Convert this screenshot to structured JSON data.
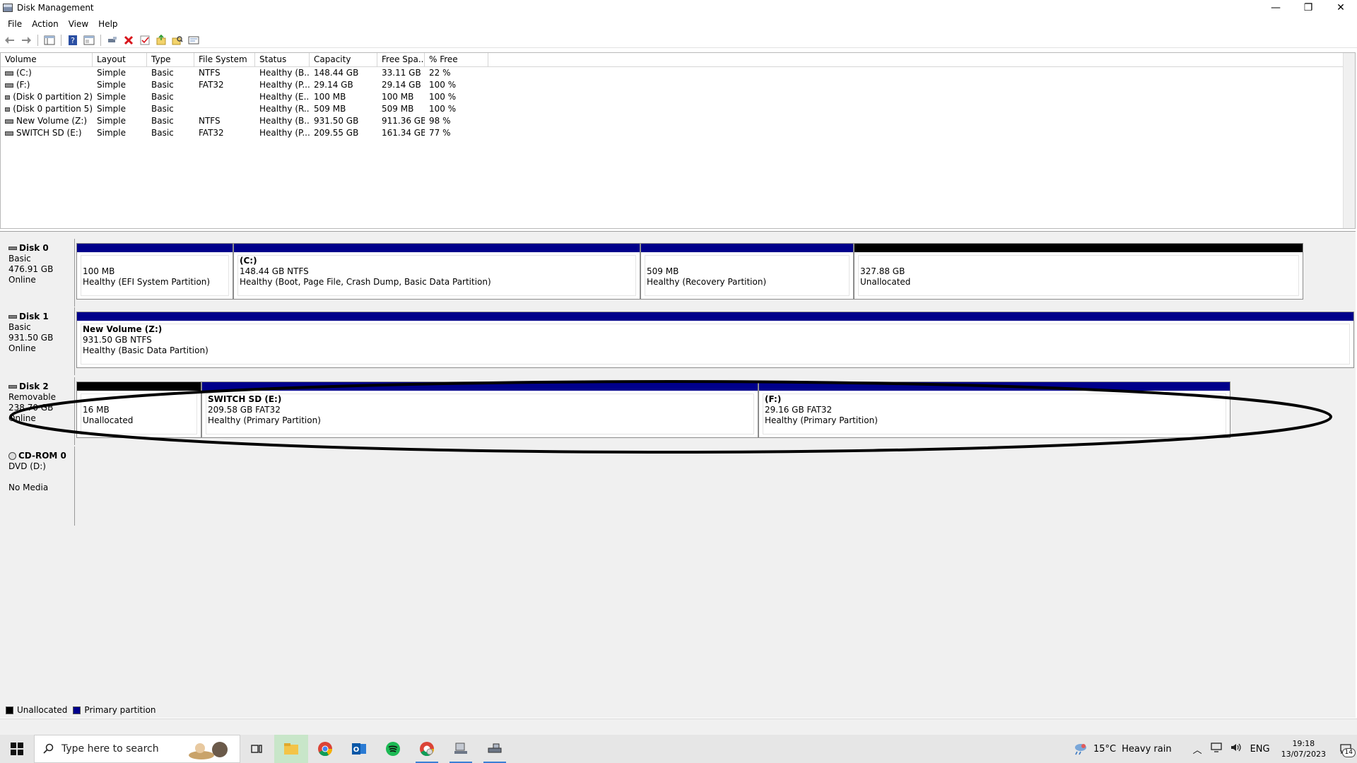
{
  "window": {
    "title": "Disk Management",
    "controls": [
      "—",
      "❐",
      "✕"
    ]
  },
  "menu": [
    "File",
    "Action",
    "View",
    "Help"
  ],
  "toolbar": [
    "back-arrow-icon",
    "forward-arrow-icon",
    "console-tree-icon",
    "help-icon",
    "properties-icon",
    "connect-icon",
    "delete-icon",
    "check-icon",
    "rescan-icon",
    "search-disk-icon",
    "settings-list-icon"
  ],
  "volume_table": {
    "columns": [
      "Volume",
      "Layout",
      "Type",
      "File System",
      "Status",
      "Capacity",
      "Free Spa...",
      "% Free"
    ],
    "rows": [
      [
        "(C:)",
        "Simple",
        "Basic",
        "NTFS",
        "Healthy (B...",
        "148.44 GB",
        "33.11 GB",
        "22 %"
      ],
      [
        "(F:)",
        "Simple",
        "Basic",
        "FAT32",
        "Healthy (P...",
        "29.14 GB",
        "29.14 GB",
        "100 %"
      ],
      [
        "(Disk 0 partition 2)",
        "Simple",
        "Basic",
        "",
        "Healthy (E...",
        "100 MB",
        "100 MB",
        "100 %"
      ],
      [
        "(Disk 0 partition 5)",
        "Simple",
        "Basic",
        "",
        "Healthy (R...",
        "509 MB",
        "509 MB",
        "100 %"
      ],
      [
        "New Volume (Z:)",
        "Simple",
        "Basic",
        "NTFS",
        "Healthy (B...",
        "931.50 GB",
        "911.36 GB",
        "98 %"
      ],
      [
        "SWITCH SD (E:)",
        "Simple",
        "Basic",
        "FAT32",
        "Healthy (P...",
        "209.55 GB",
        "161.34 GB",
        "77 %"
      ]
    ]
  },
  "disks": [
    {
      "name": "Disk 0",
      "kind": "Basic",
      "size": "476.91 GB",
      "state": "Online",
      "partitions": [
        {
          "label": "",
          "line1": "100 MB",
          "line2": "Healthy (EFI System Partition)",
          "bar": "primary"
        },
        {
          "label": "(C:)",
          "line1": "148.44 GB NTFS",
          "line2": "Healthy (Boot, Page File, Crash Dump, Basic Data Partition)",
          "bar": "primary"
        },
        {
          "label": "",
          "line1": "509 MB",
          "line2": "Healthy (Recovery Partition)",
          "bar": "primary"
        },
        {
          "label": "",
          "line1": "327.88 GB",
          "line2": "Unallocated",
          "bar": "unalloc"
        }
      ]
    },
    {
      "name": "Disk 1",
      "kind": "Basic",
      "size": "931.50 GB",
      "state": "Online",
      "partitions": [
        {
          "label": "New Volume  (Z:)",
          "line1": "931.50 GB NTFS",
          "line2": "Healthy (Basic Data Partition)",
          "bar": "primary"
        }
      ]
    },
    {
      "name": "Disk 2",
      "kind": "Removable",
      "size": "238.70 GB",
      "state": "Online",
      "partitions": [
        {
          "label": "",
          "line1": "16 MB",
          "line2": "Unallocated",
          "bar": "unalloc"
        },
        {
          "label": "SWITCH SD  (E:)",
          "line1": "209.58 GB FAT32",
          "line2": "Healthy (Primary Partition)",
          "bar": "primary"
        },
        {
          "label": "(F:)",
          "line1": "29.16 GB FAT32",
          "line2": "Healthy (Primary Partition)",
          "bar": "primary"
        }
      ]
    },
    {
      "name": "CD-ROM 0",
      "kind": "DVD (D:)",
      "size": "",
      "state": "No Media",
      "partitions": []
    }
  ],
  "legend": [
    {
      "label": "Unallocated",
      "color": "#000000"
    },
    {
      "label": "Primary partition",
      "color": "#00008b"
    }
  ],
  "taskbar": {
    "search_placeholder": "Type here to search",
    "weather": {
      "temp": "15°C",
      "desc": "Heavy rain"
    },
    "lang": "ENG",
    "time": "19:18",
    "date": "13/07/2023",
    "notification_count": "14"
  },
  "colors": {
    "primary": "#00008b",
    "unallocated": "#000000",
    "pane": "#f0f0f0"
  }
}
